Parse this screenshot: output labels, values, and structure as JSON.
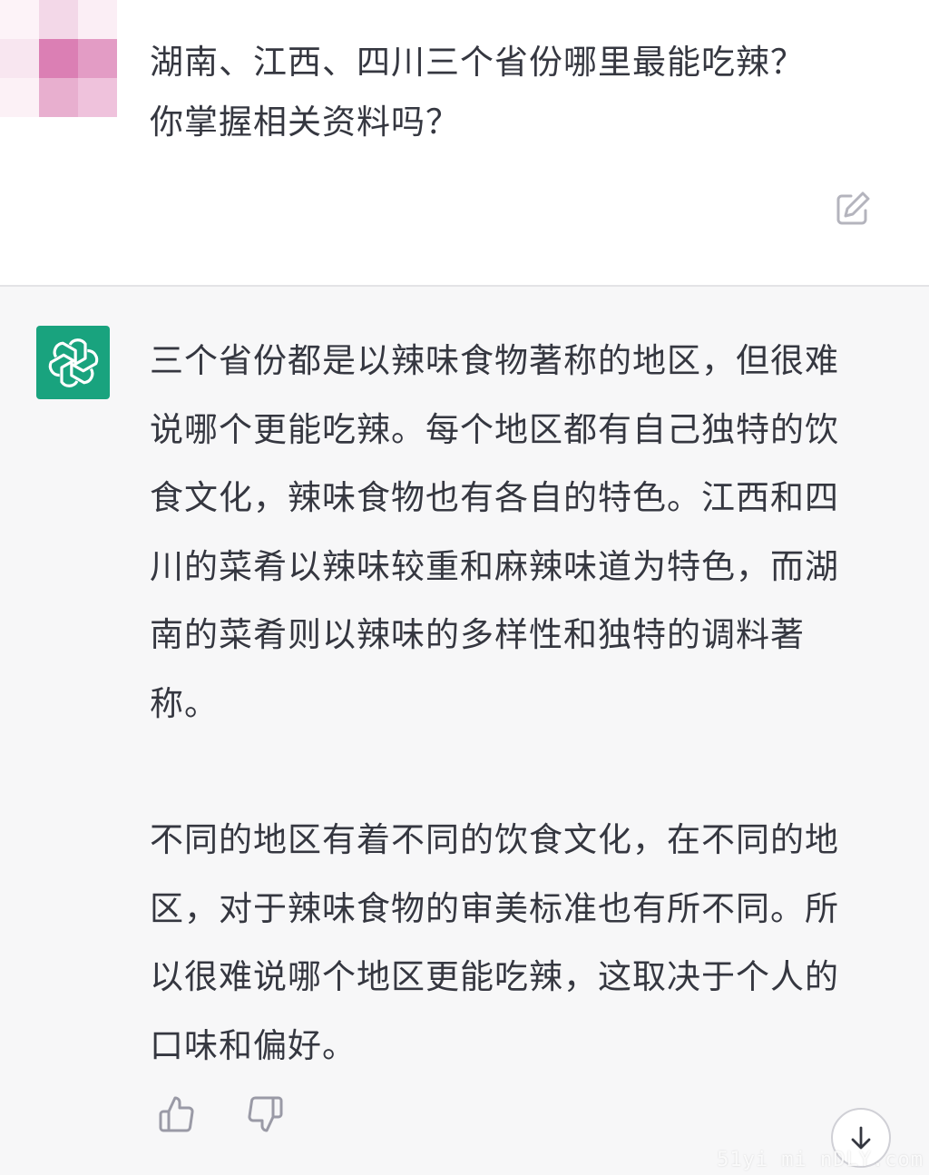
{
  "user_message": {
    "text": "湖南、江西、四川三个省份哪里最能吃辣？你掌握相关资料吗？",
    "avatar_icon": "pixelated-user-avatar"
  },
  "edit_icon": "pencil-square-icon",
  "assistant_message": {
    "avatar_icon": "openai-logo-icon",
    "avatar_color": "#19a37e",
    "paragraphs": [
      "三个省份都是以辣味食物著称的地区，但很难说哪个更能吃辣。每个地区都有自己独特的饮食文化，辣味食物也有各自的特色。江西和四川的菜肴以辣味较重和麻辣味道为特色，而湖南的菜肴则以辣味的多样性和独特的调料著称。",
      "不同的地区有着不同的饮食文化，在不同的地区，对于辣味食物的审美标准也有所不同。所以很难说哪个地区更能吃辣，这取决于个人的口味和偏好。"
    ]
  },
  "actions": {
    "thumbs_up_icon": "thumbs-up-icon",
    "thumbs_down_icon": "thumbs-down-icon",
    "scroll_down_icon": "arrow-down-icon"
  },
  "watermark": "51yi mi nDLY.com"
}
